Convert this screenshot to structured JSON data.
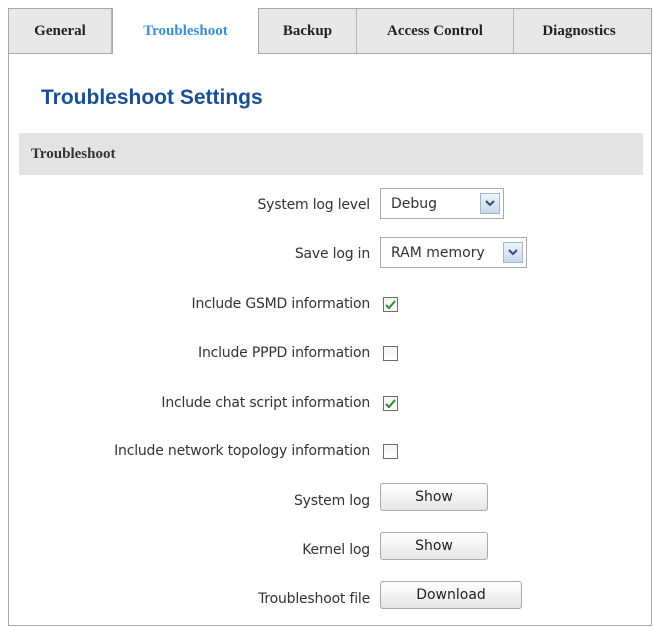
{
  "tabs": [
    {
      "label": "General"
    },
    {
      "label": "Troubleshoot",
      "active": true
    },
    {
      "label": "Backup"
    },
    {
      "label": "Access Control"
    },
    {
      "label": "Diagnostics"
    }
  ],
  "page_title": "Troubleshoot Settings",
  "section_title": "Troubleshoot",
  "fields": {
    "system_log_level": {
      "label": "System log level",
      "value": "Debug"
    },
    "save_log_in": {
      "label": "Save log in",
      "value": "RAM memory"
    },
    "include_gsmd": {
      "label": "Include GSMD information",
      "checked": true
    },
    "include_pppd": {
      "label": "Include PPPD information",
      "checked": false
    },
    "include_chat": {
      "label": "Include chat script information",
      "checked": true
    },
    "include_topology": {
      "label": "Include network topology information",
      "checked": false
    },
    "system_log": {
      "label": "System log",
      "button": "Show"
    },
    "kernel_log": {
      "label": "Kernel log",
      "button": "Show"
    },
    "troubleshoot_file": {
      "label": "Troubleshoot file",
      "button": "Download"
    }
  },
  "colors": {
    "accent": "#3b8fd6",
    "title": "#1b4f93",
    "check": "#2e8b2e"
  },
  "icons": {
    "dropdown": "chevron-down-icon",
    "checkmark": "checkmark-icon"
  }
}
